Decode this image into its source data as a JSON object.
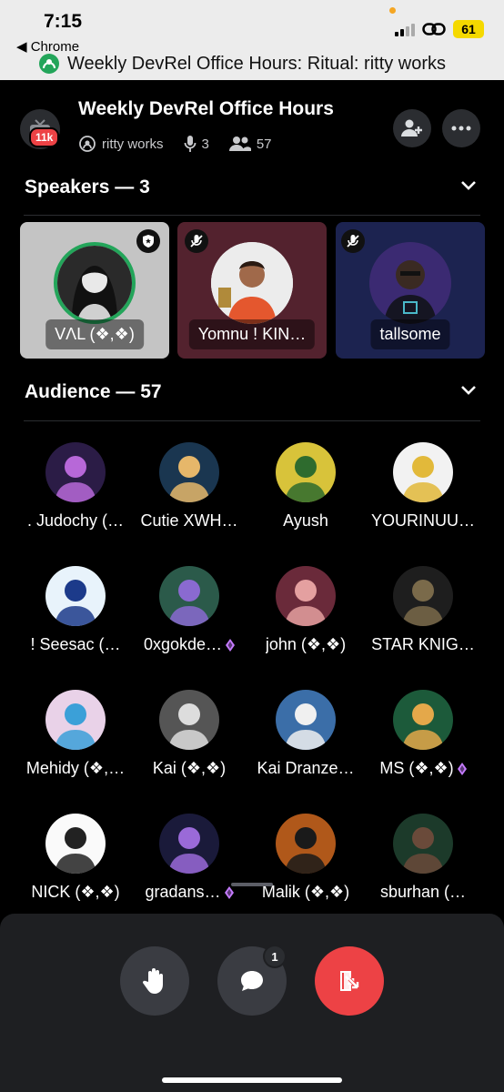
{
  "status_bar": {
    "time": "7:15",
    "back_app": "◀ Chrome",
    "battery": "61",
    "page_title": "Weekly DevRel Office Hours: Ritual: ritty works"
  },
  "header": {
    "server_badge": "11k",
    "title": "Weekly DevRel Office Hours",
    "host": "ritty works",
    "speaker_count": "3",
    "listener_count": "57"
  },
  "speakers_section": {
    "label": "Speakers — 3"
  },
  "speakers": [
    {
      "name": "VΛL (❖,❖)"
    },
    {
      "name": "Yomnu ! KIN…"
    },
    {
      "name": "tallsome"
    }
  ],
  "audience_section": {
    "label": "Audience — 57"
  },
  "audience": [
    {
      "name": ". Judochy (…"
    },
    {
      "name": "Cutie XWH…"
    },
    {
      "name": "Ayush"
    },
    {
      "name": "YOURINUU…"
    },
    {
      "name": "! Seesac (…"
    },
    {
      "name": "0xgokde…"
    },
    {
      "name": "john (❖,❖)"
    },
    {
      "name": "STAR KNIG…"
    },
    {
      "name": "Mehidy (❖,…"
    },
    {
      "name": "Kai (❖,❖)"
    },
    {
      "name": "Kai Dranze…"
    },
    {
      "name": "MS (❖,❖)"
    },
    {
      "name": "NICK (❖,❖)"
    },
    {
      "name": "gradans…"
    },
    {
      "name": "Malik (❖,❖)"
    },
    {
      "name": "sburhan (…"
    }
  ],
  "controls": {
    "chat_badge": "1"
  },
  "colors": {
    "background": "#000000",
    "panel": "#1e1f22",
    "leave": "#ed4245",
    "gem": "#c57bff",
    "speaker_ring": "#23a55a"
  }
}
